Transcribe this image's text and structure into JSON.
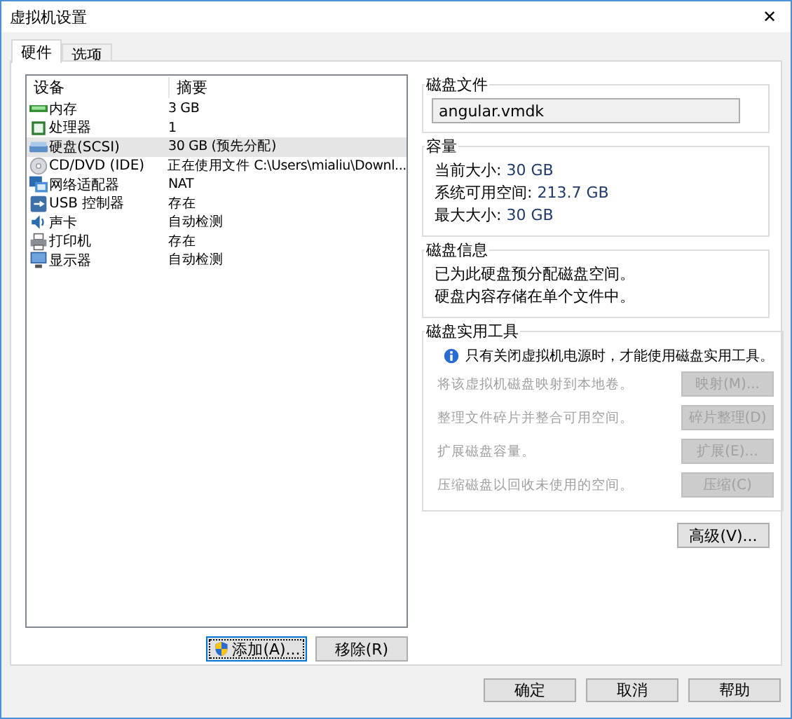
{
  "window": {
    "title": "虚拟机设置",
    "close": "✕"
  },
  "tabs": [
    {
      "label": "硬件",
      "selected": true
    },
    {
      "label": "选项",
      "selected": false
    }
  ],
  "device_list": {
    "columns": [
      "设备",
      "摘要"
    ],
    "rows": [
      {
        "kind": "memory",
        "device": "内存",
        "summary": "3 GB",
        "selected": false
      },
      {
        "kind": "cpu",
        "device": "处理器",
        "summary": "1",
        "selected": false
      },
      {
        "kind": "disk",
        "device": "硬盘(SCSI)",
        "summary": "30 GB (预先分配)",
        "selected": true
      },
      {
        "kind": "cdrom",
        "device": "CD/DVD (IDE)",
        "summary": "正在使用文件 C:\\Users\\mialiu\\Downl...",
        "selected": false
      },
      {
        "kind": "network",
        "device": "网络适配器",
        "summary": "NAT",
        "selected": false
      },
      {
        "kind": "usb",
        "device": "USB 控制器",
        "summary": "存在",
        "selected": false
      },
      {
        "kind": "sound",
        "device": "声卡",
        "summary": "自动检测",
        "selected": false
      },
      {
        "kind": "printer",
        "device": "打印机",
        "summary": "存在",
        "selected": false
      },
      {
        "kind": "display",
        "device": "显示器",
        "summary": "自动检测",
        "selected": false
      }
    ]
  },
  "list_buttons": [
    {
      "label": "添加(A)...",
      "shield": true
    },
    {
      "label": "移除(R)",
      "shield": false
    }
  ],
  "disk_file": {
    "title": "磁盘文件",
    "value": "angular.vmdk"
  },
  "capacity": {
    "title": "容量",
    "items": [
      {
        "label": "当前大小:",
        "value": "30 GB"
      },
      {
        "label": "系统可用空间:",
        "value": "213.7 GB"
      },
      {
        "label": "最大大小:",
        "value": "30 GB"
      }
    ]
  },
  "disk_info": {
    "title": "磁盘信息",
    "lines": [
      "已为此硬盘预分配磁盘空间。",
      "硬盘内容存储在单个文件中。"
    ]
  },
  "disk_utilities": {
    "title": "磁盘实用工具",
    "note": "只有关闭虚拟机电源时，才能使用磁盘实用工具。",
    "rows": [
      {
        "text": "将该虚拟机磁盘映射到本地卷。",
        "button": "映射(M)...",
        "disabled": true
      },
      {
        "text": "整理文件碎片并整合可用空间。",
        "button": "碎片整理(D)",
        "disabled": true
      },
      {
        "text": "扩展磁盘容量。",
        "button": "扩展(E)...",
        "disabled": true
      },
      {
        "text": "压缩磁盘以回收未使用的空间。",
        "button": "压缩(C)",
        "disabled": true
      }
    ]
  },
  "advanced_button": "高级(V)...",
  "footer_buttons": [
    "确定",
    "取消",
    "帮助"
  ]
}
